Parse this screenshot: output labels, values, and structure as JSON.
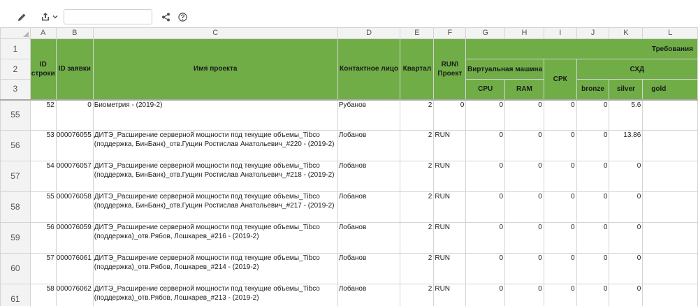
{
  "toolbar": {
    "edit_icon": "pencil-icon",
    "export_icon": "export-icon",
    "search_value": "",
    "share_icon": "share-icon",
    "help_icon": "help-icon"
  },
  "columns": [
    "A",
    "B",
    "C",
    "D",
    "E",
    "F",
    "G",
    "H",
    "I",
    "J",
    "K",
    "L"
  ],
  "header_rows": [
    "1",
    "2",
    "3"
  ],
  "header": {
    "id_row": "ID строки",
    "id_request": "ID заявки",
    "project_name": "Имя проекта",
    "contact": "Контактное лицо",
    "quarter": "Квартал",
    "run_project": "RUN\\ Проект",
    "requirements": "Требования",
    "vm": "Виртуальная машина",
    "cpu": "CPU",
    "ram": "RAM",
    "srk": "СРК",
    "shd": "СХД",
    "bronze": "bronze",
    "silver": "silver",
    "gold": "gold"
  },
  "rows": [
    {
      "row_num": "55",
      "id": "52",
      "req": "0",
      "name1": "Биометрия - (2019-2)",
      "name2": "",
      "contact": "Рубанов",
      "quarter": "2",
      "run": "0",
      "run_align": "num",
      "cpu": "0",
      "ram": "0",
      "srk": "0",
      "bronze": "0",
      "silver": "5.6",
      "gold": ""
    },
    {
      "row_num": "56",
      "id": "53",
      "req": "000076055",
      "name1": "ДИТЭ_Расширение серверной мощности под текущие объемы_Tibco",
      "name2": "(поддержка, БинБанк)_отв.Гущин Ростислав Анатольевич_#220 - (2019-2)",
      "contact": "Лобанов",
      "quarter": "2",
      "run": "RUN",
      "run_align": "txt",
      "cpu": "0",
      "ram": "0",
      "srk": "0",
      "bronze": "0",
      "silver": "13.86",
      "gold": ""
    },
    {
      "row_num": "57",
      "id": "54",
      "req": "000076057",
      "name1": "ДИТЭ_Расширение серверной мощности под текущие объемы_Tibco",
      "name2": "(поддержка, БинБанк)_отв.Гущин Ростислав Анатольевич_#218 - (2019-2)",
      "contact": "Лобанов",
      "quarter": "2",
      "run": "RUN",
      "run_align": "txt",
      "cpu": "0",
      "ram": "0",
      "srk": "0",
      "bronze": "0",
      "silver": "0",
      "gold": ""
    },
    {
      "row_num": "58",
      "id": "55",
      "req": "000076058",
      "name1": "ДИТЭ_Расширение серверной мощности под текущие объемы_Tibco",
      "name2": "(поддержка, БинБанк)_отв.Гущин Ростислав Анатольевич_#217 - (2019-2)",
      "contact": "Лобанов",
      "quarter": "2",
      "run": "RUN",
      "run_align": "txt",
      "cpu": "0",
      "ram": "0",
      "srk": "0",
      "bronze": "0",
      "silver": "0",
      "gold": ""
    },
    {
      "row_num": "59",
      "id": "56",
      "req": "000076059",
      "name1": "ДИТЭ_Расширение серверной мощности под текущие объемы_Tibco",
      "name2": "(поддержка)_отв.Рябов, Лошкарев_#216 - (2019-2)",
      "contact": "Лобанов",
      "quarter": "2",
      "run": "RUN",
      "run_align": "txt",
      "cpu": "0",
      "ram": "0",
      "srk": "0",
      "bronze": "0",
      "silver": "0",
      "gold": ""
    },
    {
      "row_num": "60",
      "id": "57",
      "req": "000076061",
      "name1": "ДИТЭ_Расширение серверной мощности под текущие объемы_Tibco",
      "name2": "(поддержка)_отв.Рябов, Лошкарев_#214 - (2019-2)",
      "contact": "Лобанов",
      "quarter": "2",
      "run": "RUN",
      "run_align": "txt",
      "cpu": "0",
      "ram": "0",
      "srk": "0",
      "bronze": "0",
      "silver": "0",
      "gold": ""
    },
    {
      "row_num": "61",
      "id": "58",
      "req": "000076062",
      "name1": "ДИТЭ_Расширение серверной мощности под текущие объемы_Tibco",
      "name2": "(поддержка)_отв.Рябов, Лошкарев_#213 - (2019-2)",
      "contact": "Лобанов",
      "quarter": "2",
      "run": "RUN",
      "run_align": "txt",
      "cpu": "0",
      "ram": "0",
      "srk": "0",
      "bronze": "0",
      "silver": "0",
      "gold": ""
    }
  ]
}
